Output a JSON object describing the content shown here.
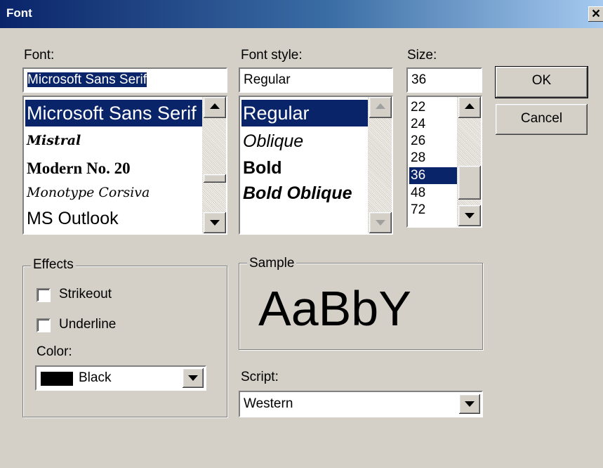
{
  "window": {
    "title": "Font",
    "close_glyph": "×"
  },
  "font": {
    "label": "Font:",
    "value": "Microsoft Sans Serif",
    "items": [
      "Microsoft Sans Serif",
      "Mistral",
      "Modern No. 20",
      "Monotype Corsiva",
      "MS Outlook"
    ],
    "selected_index": 0
  },
  "style": {
    "label": "Font style:",
    "value": "Regular",
    "items": [
      "Regular",
      "Oblique",
      "Bold",
      "Bold Oblique"
    ],
    "selected_index": 0
  },
  "size": {
    "label": "Size:",
    "value": "36",
    "items": [
      "22",
      "24",
      "26",
      "28",
      "36",
      "48",
      "72"
    ],
    "selected_index": 4
  },
  "buttons": {
    "ok": "OK",
    "cancel": "Cancel"
  },
  "effects": {
    "legend": "Effects",
    "strikeout": "Strikeout",
    "underline": "Underline",
    "strikeout_checked": false,
    "underline_checked": false,
    "color_label": "Color:",
    "color_value": "Black",
    "color_swatch": "#000000"
  },
  "sample": {
    "legend": "Sample",
    "text": "AaBbY"
  },
  "script": {
    "label": "Script:",
    "value": "Western"
  },
  "icons": {
    "scroll_up": "triangle-up",
    "scroll_down": "triangle-down",
    "dropdown": "triangle-down"
  },
  "colors": {
    "titlebar_start": "#0a246a",
    "titlebar_end": "#a6caf0",
    "selection": "#0a246a",
    "face": "#d4d0c8"
  }
}
